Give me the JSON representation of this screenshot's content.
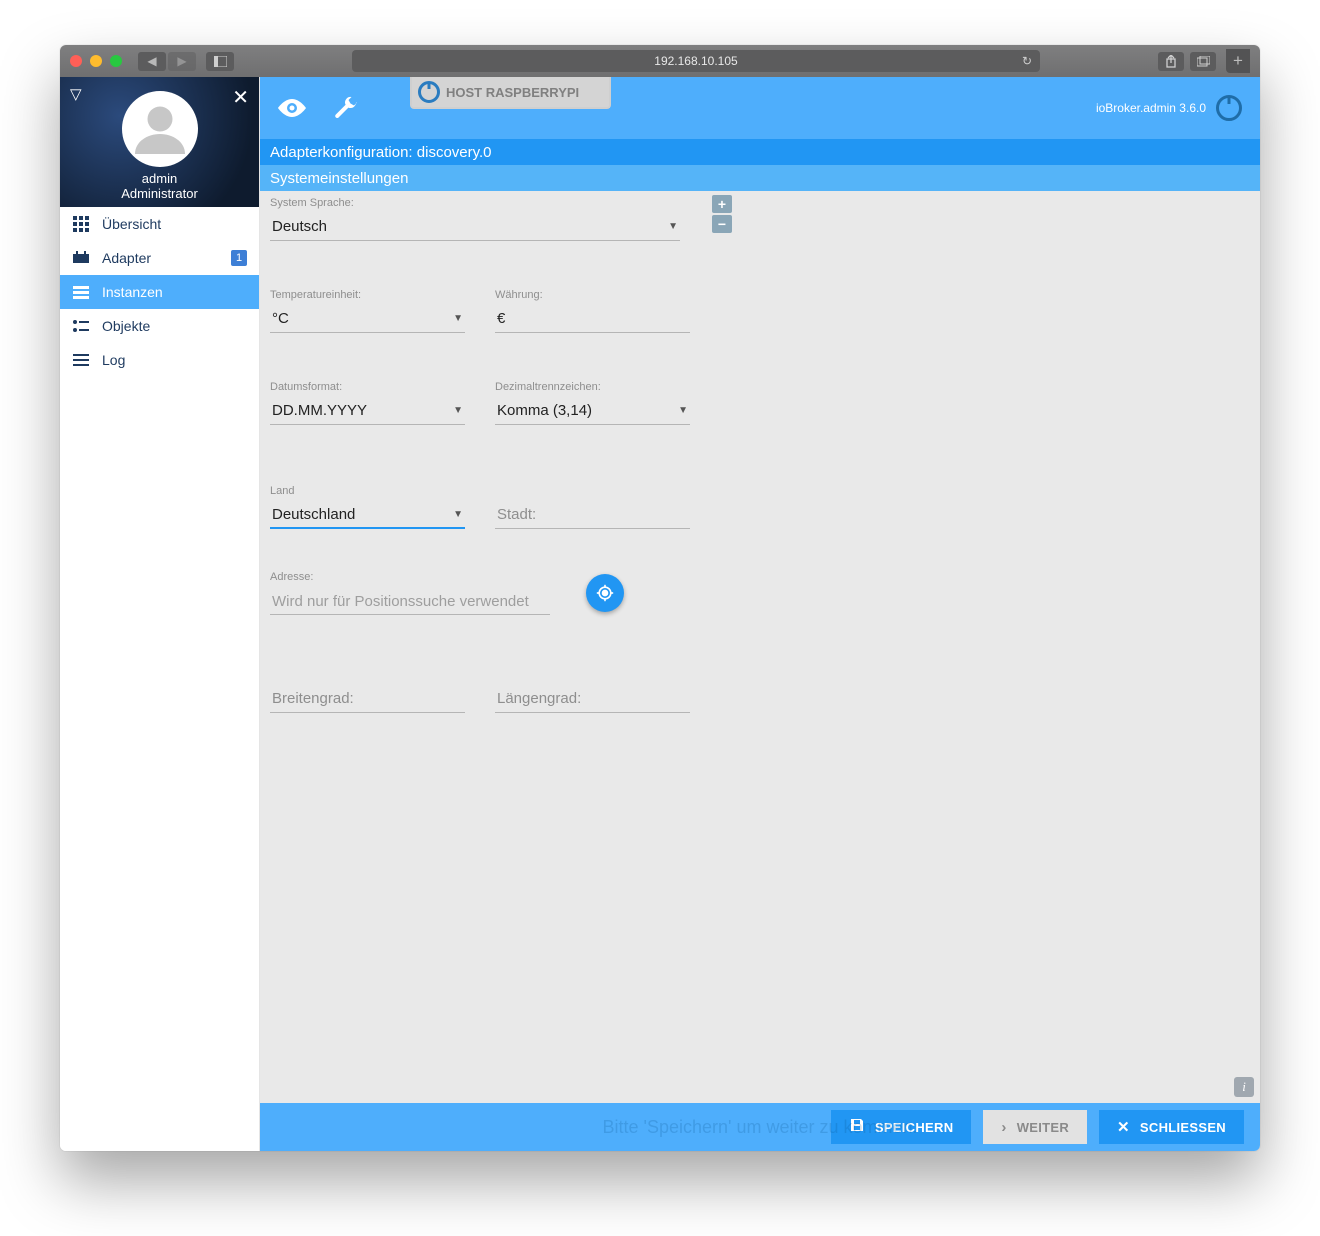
{
  "browser": {
    "url": "192.168.10.105"
  },
  "sidebar": {
    "user_name": "admin",
    "user_role": "Administrator",
    "items": [
      {
        "label": "Übersicht",
        "icon": "grid"
      },
      {
        "label": "Adapter",
        "icon": "adapter",
        "badge": "1"
      },
      {
        "label": "Instanzen",
        "icon": "instances",
        "active": true
      },
      {
        "label": "Objekte",
        "icon": "objects"
      },
      {
        "label": "Log",
        "icon": "log"
      }
    ]
  },
  "topbar": {
    "host": "HOST RASPBERRYPI",
    "app_version": "ioBroker.admin 3.6.0"
  },
  "headers": {
    "config_title": "Adapterkonfiguration: discovery.0",
    "section_title": "Systemeinstellungen"
  },
  "form": {
    "lang_label": "System Sprache:",
    "lang_value": "Deutsch",
    "temp_label": "Temperatureinheit:",
    "temp_value": "°C",
    "currency_label": "Währung:",
    "currency_value": "€",
    "date_label": "Datumsformat:",
    "date_value": "DD.MM.YYYY",
    "decimal_label": "Dezimaltrennzeichen:",
    "decimal_value": "Komma (3,14)",
    "country_label": "Land",
    "country_value": "Deutschland",
    "city_placeholder": "Stadt:",
    "address_label": "Adresse:",
    "address_placeholder": "Wird nur für Positionssuche verwendet",
    "lat_placeholder": "Breitengrad:",
    "lon_placeholder": "Längengrad:"
  },
  "footer": {
    "hint": "Bitte 'Speichern' um weiter zu kommen.",
    "save": "SPEICHERN",
    "next": "WEITER",
    "close": "SCHLIESSEN"
  }
}
